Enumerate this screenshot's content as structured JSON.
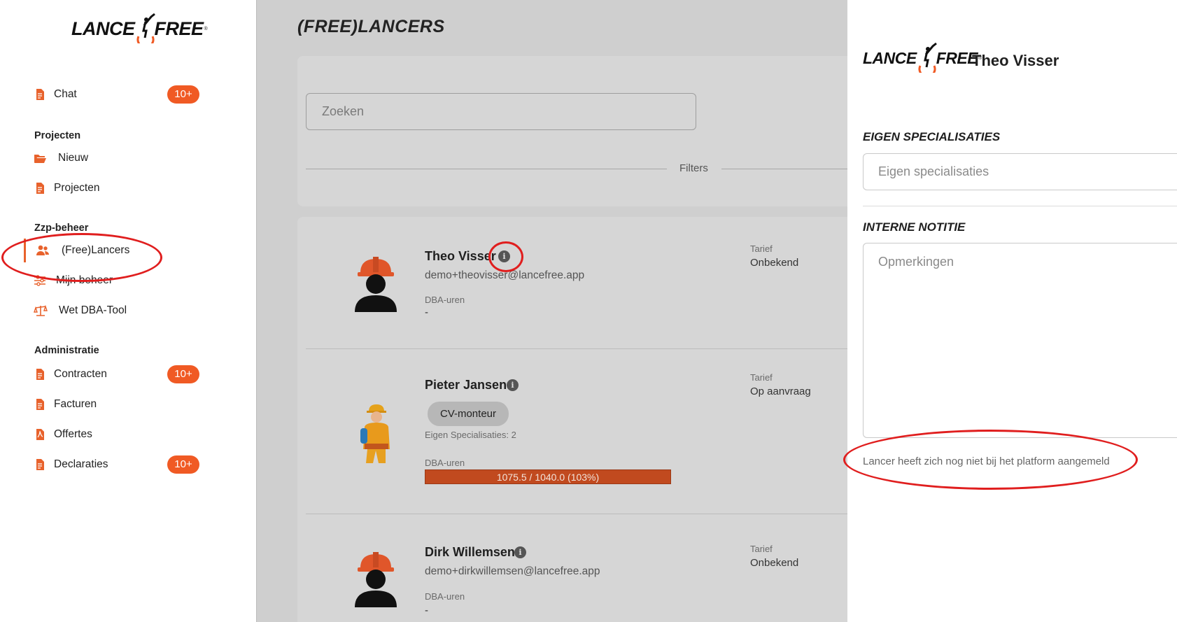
{
  "brand": {
    "logo_left": "LANCE",
    "logo_right": "FREE",
    "logo_reg": "®"
  },
  "sidebar": {
    "chat": {
      "label": "Chat",
      "badge": "10+"
    },
    "sections": {
      "projecten": "Projecten",
      "zzp": "Zzp-beheer",
      "administratie": "Administratie"
    },
    "items": {
      "nieuw": "Nieuw",
      "projecten": "Projecten",
      "freelancers": "(Free)Lancers",
      "mijn_beheer": "Mijn beheer",
      "wet_dba": "Wet DBA-Tool",
      "contracten": {
        "label": "Contracten",
        "badge": "10+"
      },
      "facturen": "Facturen",
      "offertes": "Offertes",
      "declaraties": {
        "label": "Declaraties",
        "badge": "10+"
      }
    }
  },
  "main": {
    "title": "(FREE)LANCERS",
    "search": {
      "placeholder": "Zoeken"
    },
    "filters_label": "Filters",
    "freelancers": [
      {
        "name": "Theo Visser",
        "email": "demo+theovisser@lancefree.app",
        "dba_label": "DBA-uren",
        "dba_value": "-",
        "tarief_label": "Tarief",
        "tarief_value": "Onbekend"
      },
      {
        "name": "Pieter Jansen",
        "chip": "CV-monteur",
        "specialisaties": "Eigen Specialisaties: 2",
        "dba_label": "DBA-uren",
        "dba_progress_text": "1075.5 / 1040.0 (103%)",
        "dba_progress": 1.0,
        "tarief_label": "Tarief",
        "tarief_value": "Op aanvraag"
      },
      {
        "name": "Dirk Willemsen",
        "email": "demo+dirkwillemsen@lancefree.app",
        "dba_label": "DBA-uren",
        "dba_value": "-",
        "tarief_label": "Tarief",
        "tarief_value": "Onbekend"
      }
    ]
  },
  "drawer": {
    "name": "Theo Visser",
    "eigen_heading": "EIGEN SPECIALISATIES",
    "eigen_placeholder": "Eigen specialisaties",
    "notitie_heading": "INTERNE NOTITIE",
    "notitie_placeholder": "Opmerkingen",
    "note": "Lancer heeft zich nog niet bij het platform aangemeld"
  },
  "colors": {
    "accent": "#f05a24",
    "annotation": "#e01e1e",
    "overlay": "#cfcfcf",
    "progress": "#c14a1f"
  }
}
